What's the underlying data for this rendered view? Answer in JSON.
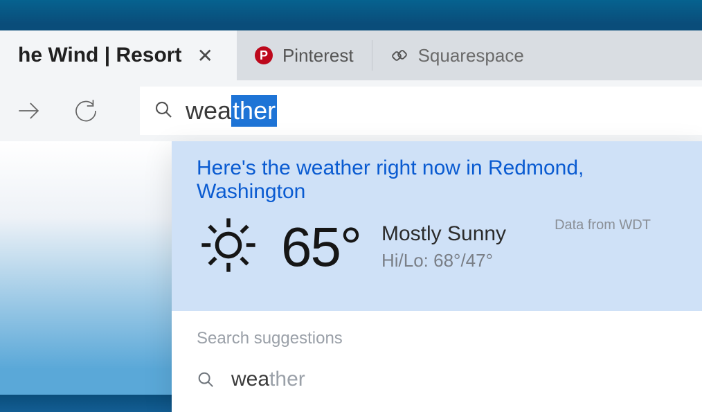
{
  "tabs": {
    "active": {
      "title": "he Wind | Resort"
    },
    "pinterest": {
      "title": "Pinterest"
    },
    "squarespace": {
      "title": "Squarespace"
    }
  },
  "address": {
    "typed": "wea",
    "completed": "ther"
  },
  "weather": {
    "headline": "Here's the weather right now in Redmond, Washington",
    "temp": "65°",
    "condition": "Mostly Sunny",
    "hilo": "Hi/Lo: 68°/47°",
    "attribution": "Data from WDT"
  },
  "suggestions": {
    "header": "Search suggestions",
    "item1_typed": "wea",
    "item1_rest": "ther"
  }
}
